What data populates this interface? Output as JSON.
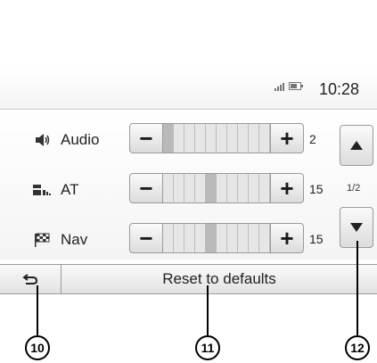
{
  "status_bar": {
    "time": "10:28",
    "signal_icon": "signal-icon",
    "battery_icon": "battery-icon"
  },
  "rows": [
    {
      "label": "Audio",
      "value": "2",
      "icon": "speaker-icon",
      "level_segments_filled": 0.15
    },
    {
      "label": "AT",
      "value": "15",
      "icon": "traffic-info-icon",
      "level_segments_filled": 0.45
    },
    {
      "label": "Nav",
      "value": "15",
      "icon": "checkered-flag-icon",
      "level_segments_filled": 0.45
    }
  ],
  "controls": {
    "minus": "−",
    "plus": "+"
  },
  "pagination": {
    "indicator": "1/2",
    "up_icon": "arrow-up-icon",
    "down_icon": "arrow-down-icon"
  },
  "bottom_bar": {
    "back_icon": "back-arrow-icon",
    "reset_label": "Reset to defaults"
  },
  "callouts": {
    "back": "10",
    "reset": "11",
    "down": "12"
  }
}
